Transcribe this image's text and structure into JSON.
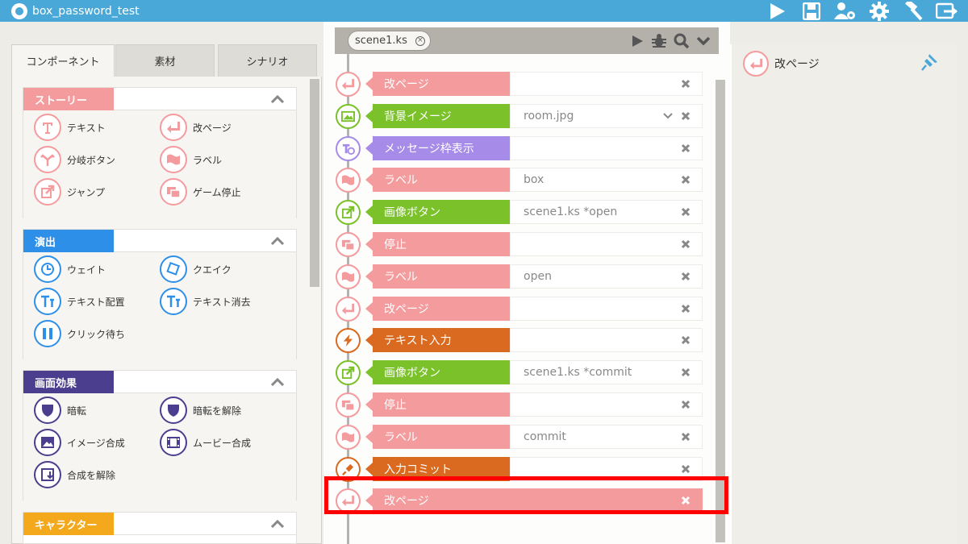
{
  "app": {
    "title": "box_password_test"
  },
  "toolbar": {
    "icons": [
      "play-icon",
      "save-icon",
      "users-settings-icon",
      "gear-icon",
      "build-hammer-icon",
      "export-icon"
    ]
  },
  "left": {
    "tabs": [
      "コンポーネント",
      "素材",
      "シナリオ"
    ],
    "sections": [
      {
        "title": "ストーリー",
        "color": "#f49b9e",
        "items": [
          "テキスト",
          "改ページ",
          "分岐ボタン",
          "ラベル",
          "ジャンプ",
          "ゲーム停止"
        ]
      },
      {
        "title": "演出",
        "color": "#2e8fe8",
        "items": [
          "ウェイト",
          "クエイク",
          "テキスト配置",
          "テキスト消去",
          "クリック待ち"
        ]
      },
      {
        "title": "画面効果",
        "color": "#4b3e8e",
        "items": [
          "暗転",
          "暗転を解除",
          "イメージ合成",
          "ムービー合成",
          "合成を解除"
        ]
      },
      {
        "title": "キャラクター",
        "color": "#f4a81c",
        "items": []
      }
    ]
  },
  "scenario": {
    "file": "scene1.ks",
    "rows": [
      {
        "label": "改ページ",
        "value": "",
        "kind": "page-break"
      },
      {
        "label": "背景イメージ",
        "value": "room.jpg",
        "kind": "bg-image",
        "dropdown": true
      },
      {
        "label": "メッセージ枠表示",
        "value": "",
        "kind": "message-frame"
      },
      {
        "label": "ラベル",
        "value": "box",
        "kind": "label"
      },
      {
        "label": "画像ボタン",
        "value": "scene1.ks *open",
        "kind": "image-button"
      },
      {
        "label": "停止",
        "value": "",
        "kind": "stop"
      },
      {
        "label": "ラベル",
        "value": "open",
        "kind": "label"
      },
      {
        "label": "改ページ",
        "value": "",
        "kind": "page-break"
      },
      {
        "label": "テキスト入力",
        "value": "",
        "kind": "text-input"
      },
      {
        "label": "画像ボタン",
        "value": "scene1.ks *commit",
        "kind": "image-button"
      },
      {
        "label": "停止",
        "value": "",
        "kind": "stop"
      },
      {
        "label": "ラベル",
        "value": "commit",
        "kind": "label"
      },
      {
        "label": "入力コミット",
        "value": "",
        "kind": "input-commit"
      },
      {
        "label": "改ページ",
        "value": "",
        "kind": "page-break",
        "selected": true
      }
    ]
  },
  "inspector": {
    "title": "改ページ"
  },
  "colors": {
    "story": "#f49b9e",
    "green": "#7ac12a",
    "purple": "#a68be8",
    "orange": "#d96a1f",
    "blue": "#2e8fe8",
    "navy": "#4b3e8e",
    "yellow": "#f4a81c",
    "highlight": "#ff0000"
  }
}
